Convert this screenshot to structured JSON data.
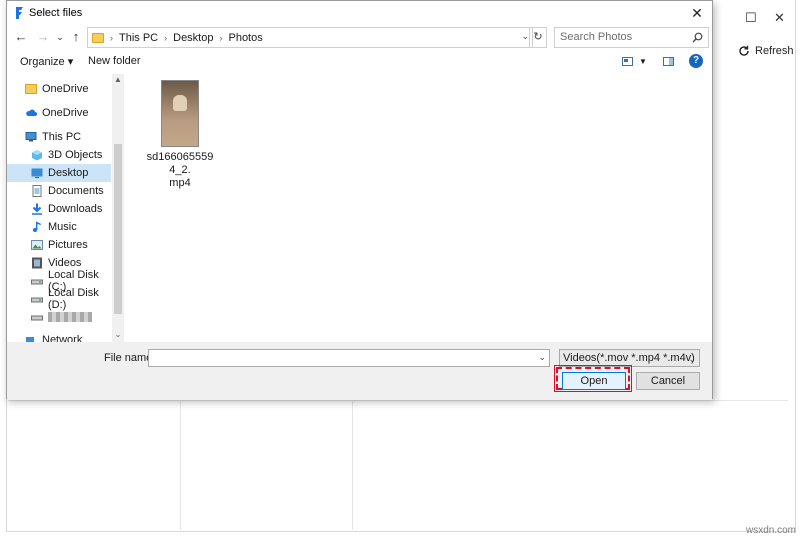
{
  "background_app": {
    "refresh_label": "Refresh",
    "maximize_icon": "square-icon",
    "close_icon": "close-icon"
  },
  "dialog": {
    "title": "Select files",
    "nav": {
      "breadcrumbs": [
        "This PC",
        "Desktop",
        "Photos"
      ],
      "search_placeholder": "Search Photos"
    },
    "toolbar": {
      "organize_label": "Organize ▾",
      "new_folder_label": "New folder",
      "help_label": "?"
    },
    "nav_pane": {
      "items": [
        {
          "label": "OneDrive",
          "icon": "folder-icon",
          "selected": false
        },
        {
          "label": "OneDrive",
          "icon": "cloud-icon",
          "selected": false
        },
        {
          "label": "This PC",
          "icon": "computer-icon",
          "selected": false
        },
        {
          "label": "3D Objects",
          "icon": "cube-icon",
          "selected": false
        },
        {
          "label": "Desktop",
          "icon": "desktop-icon",
          "selected": true
        },
        {
          "label": "Documents",
          "icon": "document-icon",
          "selected": false
        },
        {
          "label": "Downloads",
          "icon": "download-icon",
          "selected": false
        },
        {
          "label": "Music",
          "icon": "music-icon",
          "selected": false
        },
        {
          "label": "Pictures",
          "icon": "picture-icon",
          "selected": false
        },
        {
          "label": "Videos",
          "icon": "video-icon",
          "selected": false
        },
        {
          "label": "Local Disk (C:)",
          "icon": "drive-icon",
          "selected": false
        },
        {
          "label": "Local Disk (D:)",
          "icon": "drive-icon",
          "selected": false
        },
        {
          "label": "",
          "icon": "drive-icon",
          "selected": false
        },
        {
          "label": "Network",
          "icon": "network-icon",
          "selected": false
        }
      ]
    },
    "files": [
      {
        "name": "sd1660655594_2.mp4",
        "line1": "sd1660655594_2.",
        "line2": "mp4"
      }
    ],
    "bottom": {
      "file_name_label": "File name:",
      "file_name_value": "",
      "filter_value": "Videos(*.mov *.mp4 *.m4v)",
      "open_label": "Open",
      "cancel_label": "Cancel"
    }
  },
  "watermark": "wsxdn.com",
  "colors": {
    "accent": "#0078d7",
    "selected_bg": "#cce4f7",
    "highlight": "#d51030"
  }
}
